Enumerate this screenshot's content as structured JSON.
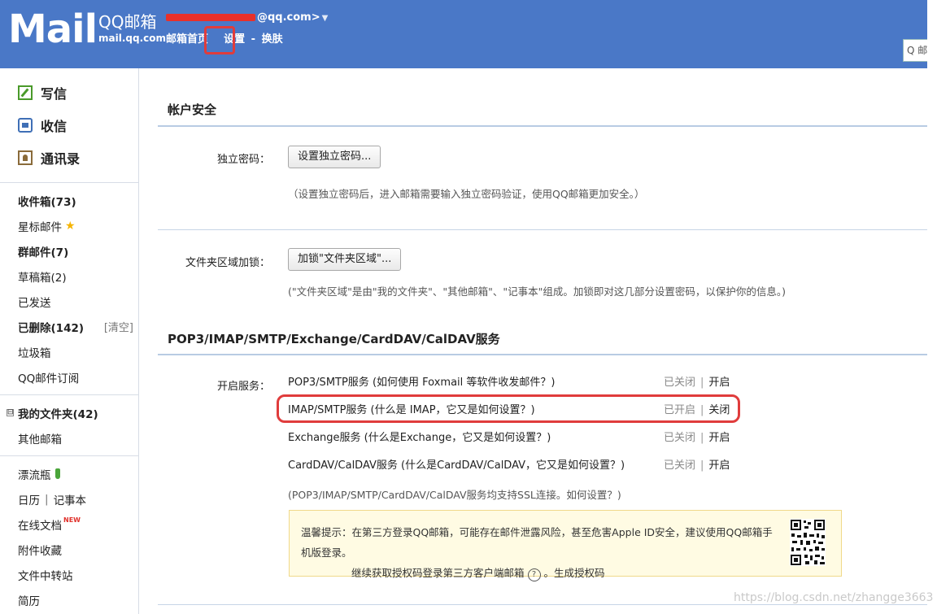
{
  "header": {
    "logo_text": "Mail",
    "brand_title": "QQ邮箱",
    "brand_domain": "mail.qq.com",
    "user_email_suffix": "@qq.com>",
    "nav": {
      "home": "邮箱首页",
      "settings": "设置",
      "sep": "-",
      "skin": "换肤"
    },
    "search_placeholder": "Q 邮"
  },
  "sidebar": {
    "actions": [
      {
        "label": "写信",
        "icon": "compose-icon"
      },
      {
        "label": "收信",
        "icon": "inbox-icon"
      },
      {
        "label": "通讯录",
        "icon": "contacts-icon"
      }
    ],
    "folders": [
      {
        "label": "收件箱(73)",
        "bold": true
      },
      {
        "label": "星标邮件",
        "icon": "star-icon"
      },
      {
        "label": "群邮件(7)",
        "bold": true
      },
      {
        "label": "草稿箱(2)"
      },
      {
        "label": "已发送"
      },
      {
        "label": "已删除(142)",
        "bold": true,
        "extra": "[清空]"
      },
      {
        "label": "垃圾箱"
      },
      {
        "label": "QQ邮件订阅"
      }
    ],
    "my_folders": {
      "label": "我的文件夹(42)",
      "expander": "⊟"
    },
    "other_mailbox": "其他邮箱",
    "apps": {
      "drift_bottle": "漂流瓶",
      "calendar": "日历",
      "calendar_sep": "|",
      "notepad": "记事本",
      "online_docs": "在线文档",
      "new_tag": "NEW",
      "attachments": "附件收藏",
      "file_transfer": "文件中转站",
      "resume": "简历"
    }
  },
  "main": {
    "account_security": {
      "title": "帐户安全",
      "pwd_label": "独立密码：",
      "pwd_button": "设置独立密码...",
      "pwd_hint": "（设置独立密码后，进入邮箱需要输入独立密码验证，使用QQ邮箱更加安全。）",
      "lock_label": "文件夹区域加锁：",
      "lock_button": "加锁\"文件夹区域\"...",
      "lock_hint": "(\"文件夹区域\"是由\"我的文件夹\"、\"其他邮箱\"、\"记事本\"组成。加锁即对这几部分设置密码，以保护你的信息。)"
    },
    "services": {
      "title": "POP3/IMAP/SMTP/Exchange/CardDAV/CalDAV服务",
      "label": "开启服务：",
      "rows": [
        {
          "name": "POP3/SMTP服务 (如何使用 Foxmail 等软件收发邮件？)",
          "status": "已关闭",
          "action": "开启"
        },
        {
          "name": "IMAP/SMTP服务 (什么是 IMAP，它又是如何设置？)",
          "status": "已开启",
          "action": "关闭"
        },
        {
          "name": "Exchange服务 (什么是Exchange，它又是如何设置？)",
          "status": "已关闭",
          "action": "开启"
        },
        {
          "name": "CardDAV/CalDAV服务 (什么是CardDAV/CalDAV，它又是如何设置？)",
          "status": "已关闭",
          "action": "开启"
        }
      ],
      "status_sep": "|",
      "ssl_hint": "(POP3/IMAP/SMTP/CardDAV/CalDAV服务均支持SSL连接。如何设置？)",
      "notice": {
        "line1": "温馨提示：在第三方登录QQ邮箱，可能存在邮件泄露风险，甚至危害Apple ID安全，建议使用QQ邮箱手机版登录。",
        "line2_prefix": "继续获取授权码登录第三方客户端邮箱",
        "help": "?",
        "line2_suffix": "。生成授权码"
      }
    }
  },
  "watermark": "https://blog.csdn.net/zhangge3663",
  "colors": {
    "header_bg": "#4a78c7",
    "highlight_red": "#e03c3c",
    "notice_bg": "#fffbe3"
  }
}
